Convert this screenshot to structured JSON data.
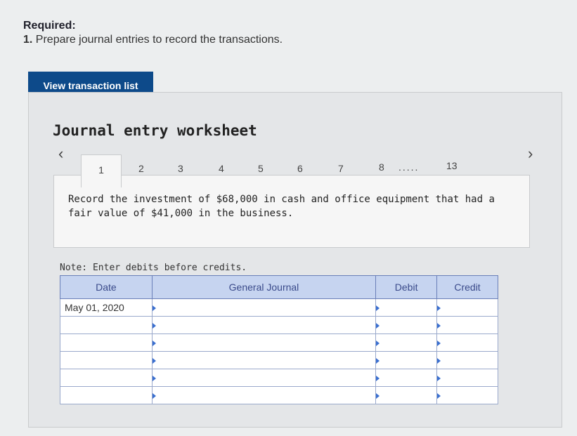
{
  "required": {
    "title": "Required:",
    "item_number": "1.",
    "item_text": "Prepare journal entries to record the transactions."
  },
  "view_button": "View transaction list",
  "worksheet": {
    "title": "Journal entry worksheet",
    "tabs": [
      "1",
      "2",
      "3",
      "4",
      "5",
      "6",
      "7",
      "8",
      "13"
    ],
    "dots": ".....",
    "active_tab": "1",
    "description": "Record the investment of $68,000 in cash and office equipment that had a fair value of $41,000 in the business.",
    "note": "Note: Enter debits before credits.",
    "table": {
      "headers": [
        "Date",
        "General Journal",
        "Debit",
        "Credit"
      ],
      "rows": [
        [
          "May 01, 2020",
          "",
          "",
          ""
        ],
        [
          "",
          "",
          "",
          ""
        ],
        [
          "",
          "",
          "",
          ""
        ],
        [
          "",
          "",
          "",
          ""
        ],
        [
          "",
          "",
          "",
          ""
        ],
        [
          "",
          "",
          "",
          ""
        ]
      ]
    }
  }
}
